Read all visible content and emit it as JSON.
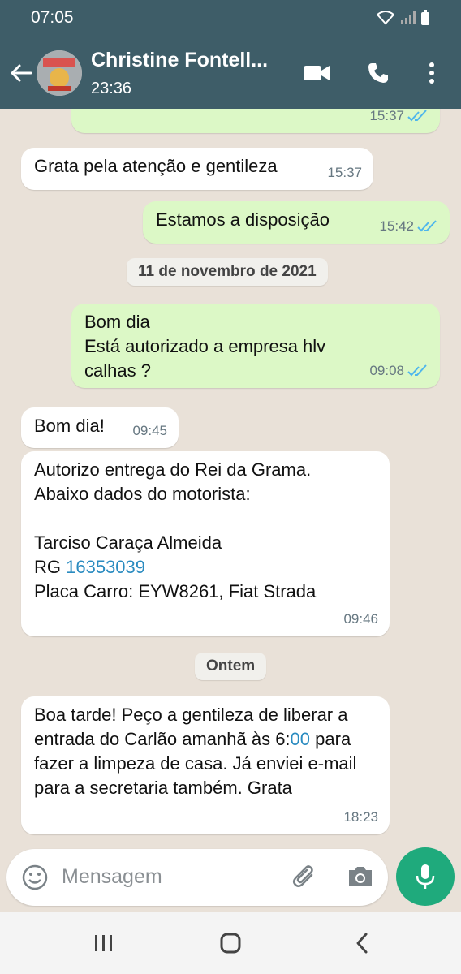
{
  "status": {
    "time": "07:05"
  },
  "header": {
    "name": "Christine Fontell...",
    "subtitle": "23:36"
  },
  "messages": [
    {
      "dir": "out",
      "text": "",
      "time": "15:37",
      "read": true
    },
    {
      "dir": "in",
      "text": "Grata pela atenção e gentileza",
      "time": "15:37"
    },
    {
      "dir": "out",
      "text": "Estamos a disposição",
      "time": "15:42",
      "read": true
    },
    {
      "type": "date",
      "text": "11 de novembro de 2021"
    },
    {
      "dir": "out",
      "text": "Bom dia\nEstá autorizado  a empresa  hlv calhas  ?",
      "time": "09:08",
      "read": true
    },
    {
      "dir": "in",
      "text": "Bom dia!",
      "time": "09:45"
    },
    {
      "dir": "in",
      "text_lines": [
        "Autorizo entrega do Rei da Grama.",
        "Abaixo dados do motorista:",
        "",
        "Tarciso Caraça Almeida"
      ],
      "rg_label": "RG ",
      "rg_value": "16353039",
      "plate": "Placa Carro: EYW8261, Fiat Strada",
      "time": "09:46"
    },
    {
      "type": "date",
      "text": "Ontem"
    },
    {
      "dir": "in",
      "text_a": "Boa tarde! Peço a gentileza de liberar a entrada do Carlão amanhã às 6:",
      "text_link": "00",
      "text_b": " para fazer a limpeza de casa. Já enviei e-mail para a secretaria também. Grata",
      "time": "18:23"
    }
  ],
  "composer": {
    "placeholder": "Mensagem"
  },
  "colors": {
    "header": "#3e5d68",
    "outgoing": "#dcf8c6",
    "incoming": "#ffffff",
    "accent": "#1faa7c",
    "link": "#2a8bc0",
    "tick": "#4fb6ec"
  },
  "icons": [
    "back-arrow-icon",
    "video-call-icon",
    "phone-icon",
    "more-options-icon",
    "emoji-icon",
    "attach-icon",
    "camera-icon",
    "mic-icon",
    "double-check-icon"
  ]
}
